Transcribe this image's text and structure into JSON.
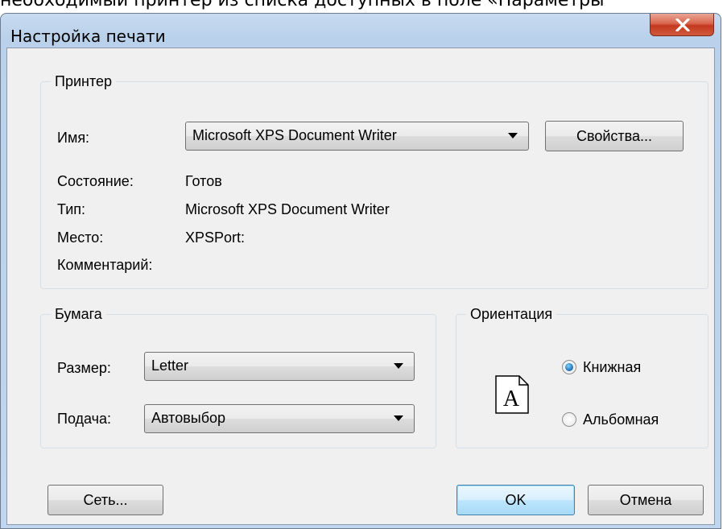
{
  "background_text": "необходимый принтер из списка доступных в поле «Параметры",
  "window": {
    "title": "Настройка печати"
  },
  "printer": {
    "legend": "Принтер",
    "name_label": "Имя:",
    "name_value": "Microsoft XPS Document Writer",
    "properties_button": "Свойства...",
    "status_label": "Состояние:",
    "status_value": "Готов",
    "type_label": "Тип:",
    "type_value": "Microsoft XPS Document Writer",
    "location_label": "Место:",
    "location_value": "XPSPort:",
    "comment_label": "Комментарий:"
  },
  "paper": {
    "legend": "Бумага",
    "size_label": "Размер:",
    "size_value": "Letter",
    "source_label": "Подача:",
    "source_value": "Автовыбор"
  },
  "orientation": {
    "legend": "Ориентация",
    "portrait_label": "Книжная",
    "landscape_label": "Альбомная",
    "selected": "portrait",
    "icon_letter": "A"
  },
  "buttons": {
    "network": "Сеть...",
    "ok": "OK",
    "cancel": "Отмена"
  }
}
